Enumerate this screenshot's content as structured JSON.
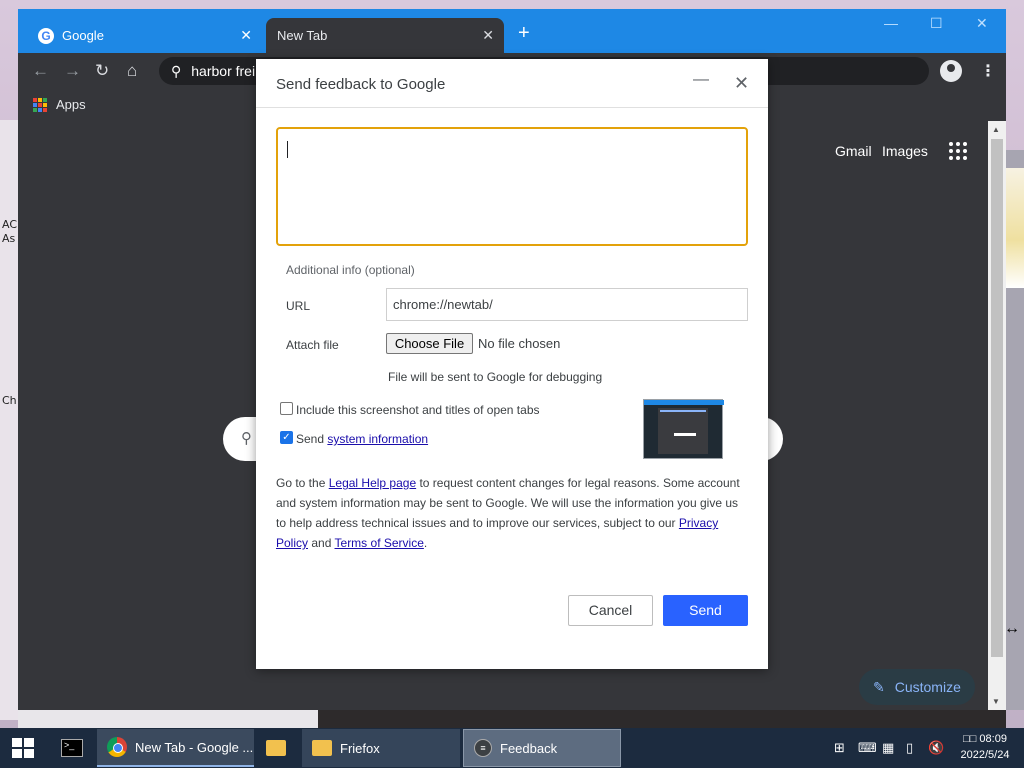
{
  "browser": {
    "tabs": [
      {
        "label": "Google"
      },
      {
        "label": "New Tab"
      }
    ],
    "omnibox_text": "harbor frei",
    "bookmarks_apps_label": "Apps",
    "header_links": {
      "gmail": "Gmail",
      "images": "Images"
    },
    "customize_label": "Customize"
  },
  "dialog": {
    "title": "Send feedback to Google",
    "additional_info_label": "Additional info (optional)",
    "url_label": "URL",
    "url_value": "chrome://newtab/",
    "attach_label": "Attach file",
    "choose_file_label": "Choose File",
    "no_file_label": "No file chosen",
    "file_note": "File will be sent to Google for debugging",
    "include_screenshot_label": "Include this screenshot and titles of open tabs",
    "include_screenshot_checked": false,
    "send_label_prefix": "Send",
    "system_info_link": "system information",
    "send_system_info_checked": true,
    "legal": {
      "p1": "Go to the",
      "legal_help_link": "Legal Help page",
      "p2": "to request content changes for legal reasons. Some account and system information may be sent to Google. We will use the information you give us to help address technical issues and to improve our services, subject to our",
      "privacy_link": "Privacy Policy",
      "p3": "and",
      "terms_link": "Terms of Service",
      "p4": "."
    },
    "cancel_label": "Cancel",
    "send_label": "Send"
  },
  "taskbar": {
    "items": [
      {
        "label": "New Tab - Google ..."
      },
      {
        "label": "Friefox"
      },
      {
        "label": "Feedback"
      }
    ],
    "clock_time": "08:09",
    "clock_date": "2022/5/24",
    "clock_prefix": "□□"
  },
  "desktop": {
    "left_fragments": [
      "AC",
      "As",
      "Ch"
    ]
  },
  "colors": {
    "tabbar": "#1e88e5",
    "send_button": "#2962ff",
    "focus_border": "#e3a20a",
    "taskbar": "#1c2b3f"
  }
}
